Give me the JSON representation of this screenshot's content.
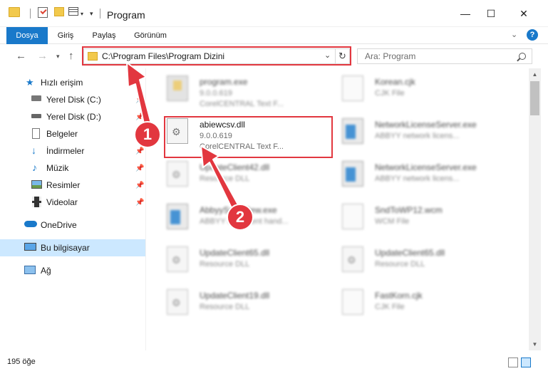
{
  "window": {
    "title": "Program",
    "minimize": "—",
    "maximize": "☐",
    "close": "✕"
  },
  "ribbon": {
    "tabs": [
      "Dosya",
      "Giriş",
      "Paylaş",
      "Görünüm"
    ],
    "help": "?"
  },
  "address": {
    "path": "C:\\Program Files\\Program Dizini",
    "search_placeholder": "Ara: Program"
  },
  "sidebar": {
    "items": [
      {
        "label": "Hızlı erişim"
      },
      {
        "label": "Yerel Disk (C:)"
      },
      {
        "label": "Yerel Disk (D:)"
      },
      {
        "label": "Belgeler"
      },
      {
        "label": "İndirmeler"
      },
      {
        "label": "Müzik"
      },
      {
        "label": "Resimler"
      },
      {
        "label": "Videolar"
      },
      {
        "label": "OneDrive"
      },
      {
        "label": "Bu bilgisayar"
      },
      {
        "label": "Ağ"
      }
    ]
  },
  "files": [
    {
      "name": "program.exe",
      "line2": "9.0.0.619",
      "line3": "CorelCENTRAL Text F...",
      "icon": "exe-icon"
    },
    {
      "name": "Korean.cjk",
      "line2": "CJK File",
      "line3": "",
      "icon": "doc-icon"
    },
    {
      "name": "abiewcsv.dll",
      "line2": "9.0.0.619",
      "line3": "CorelCENTRAL Text F...",
      "icon": "dll-icon"
    },
    {
      "name": "NetworkLicenseServer.exe",
      "line2": "ABBYY network licens...",
      "line3": "",
      "icon": "window-icon"
    },
    {
      "name": "UpdateClient42.dll",
      "line2": "Resource DLL",
      "line3": "",
      "icon": "dll-icon"
    },
    {
      "name": "NetworkLicenseServer.exe",
      "line2": "ABBYY network licens...",
      "line3": "",
      "icon": "window-icon"
    },
    {
      "name": "AbbyyScanView.exe",
      "line2": "ABBYY document hand...",
      "line3": "",
      "icon": "window-icon"
    },
    {
      "name": "SndToWP12.wcm",
      "line2": "WCM File",
      "line3": "",
      "icon": "doc-icon"
    },
    {
      "name": "UpdateClient65.dll",
      "line2": "Resource DLL",
      "line3": "",
      "icon": "dll-icon"
    },
    {
      "name": "UpdateClient65.dll",
      "line2": "Resource DLL",
      "line3": "",
      "icon": "dll-icon"
    },
    {
      "name": "UpdateClient19.dll",
      "line2": "Resource DLL",
      "line3": "",
      "icon": "dll-icon"
    },
    {
      "name": "FastKorn.cjk",
      "line2": "CJK File",
      "line3": "",
      "icon": "doc-icon"
    }
  ],
  "status": {
    "count": "195 öğe"
  },
  "annotations": {
    "step1": "1",
    "step2": "2",
    "highlight_color": "#e2373f"
  }
}
